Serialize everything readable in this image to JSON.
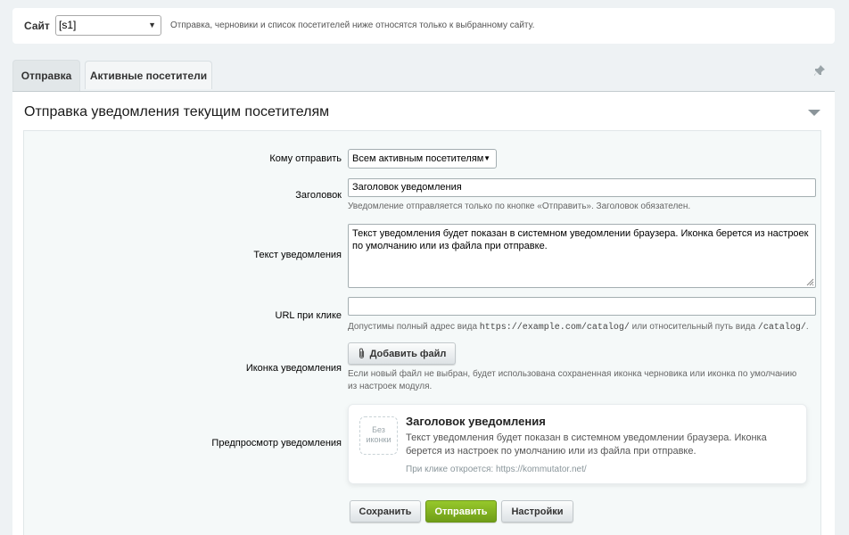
{
  "site": {
    "label": "Сайт",
    "selected": "[s1]",
    "note": "Отправка, черновики и список посетителей ниже относятся только к выбранному сайту."
  },
  "tabs": [
    {
      "label": "Отправка",
      "active": true
    },
    {
      "label": "Активные посетители",
      "active": false
    }
  ],
  "panel": {
    "title": "Отправка уведомления текущим посетителям"
  },
  "form": {
    "recipients": {
      "label": "Кому отправить",
      "selected": "Всем активным посетителям"
    },
    "title_field": {
      "label": "Заголовок",
      "value": "Заголовок уведомления",
      "hint": "Уведомление отправляется только по кнопке «Отправить». Заголовок обязателен."
    },
    "text_field": {
      "label": "Текст уведомления",
      "value": "Текст уведомления будет показан в системном уведомлении браузера. Иконка берется из настроек по умолчанию или из файла при отправке."
    },
    "url_field": {
      "label": "URL при клике",
      "value": "",
      "hint_before": "Допустимы полный адрес вида",
      "hint_code1": "https://example.com/catalog/",
      "hint_middle": "или относительный путь вида",
      "hint_code2": "/catalog/",
      "hint_after": "."
    },
    "icon_field": {
      "label": "Иконка уведомления",
      "button": "Добавить файл",
      "hint": "Если новый файл не выбран, будет использована сохраненная иконка черновика или иконка по умолчанию из настроек модуля."
    },
    "preview": {
      "label": "Предпросмотр уведомления",
      "no_icon_line1": "Без",
      "no_icon_line2": "иконки",
      "title": "Заголовок уведомления",
      "body": "Текст уведомления будет показан в системном уведомлении браузера. Иконка берется из настроек по умолчанию или из файла при отправке.",
      "link": "При клике откроется: https://kommutator.net/"
    }
  },
  "buttons": {
    "save": "Сохранить",
    "send": "Отправить",
    "settings": "Настройки"
  },
  "colors": {
    "primary_green": "#7aab1d",
    "background": "#eef2f4"
  }
}
